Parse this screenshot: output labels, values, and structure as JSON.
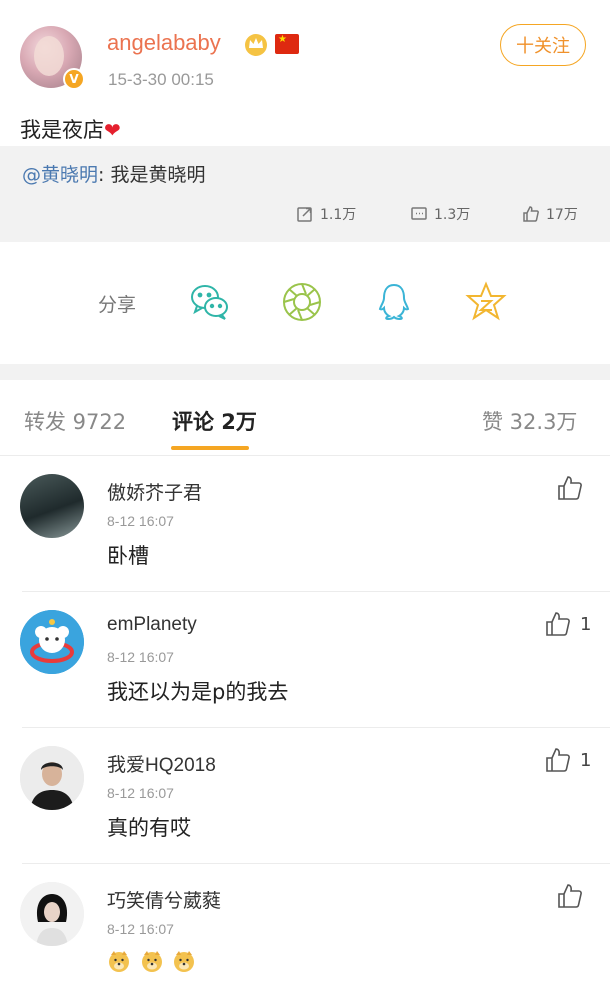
{
  "post": {
    "username": "angelababy",
    "time": "15-3-30 00:15",
    "follow_label": "十关注",
    "verified_mark": "V",
    "text": "我是夜店",
    "heart": "❤"
  },
  "repost": {
    "mention": "@黄晓明",
    "separator": ": ",
    "text": "我是黄晓明",
    "stats": {
      "reposts": "1.1万",
      "comments": "1.3万",
      "likes": "17万"
    }
  },
  "share": {
    "label": "分享",
    "icons": [
      "wechat-icon",
      "moments-icon",
      "qq-icon",
      "qzone-icon"
    ]
  },
  "tabs": {
    "reposts": "转发 9722",
    "comments": "评论 2万",
    "likes": "赞 32.3万"
  },
  "comments": [
    {
      "name": "傲娇芥子君",
      "time": "8-12 16:07",
      "text": "卧槽",
      "likes": ""
    },
    {
      "name": "emPlanety",
      "time": "8-12 16:07",
      "text": "我还以为是p的我去",
      "likes": "1"
    },
    {
      "name": "我爱HQ2018",
      "time": "8-12 16:07",
      "text": "真的有哎",
      "likes": "1"
    },
    {
      "name": "巧笑倩兮葳蕤",
      "time": "8-12 16:07",
      "text": "",
      "likes": "",
      "emoji": [
        "doge-emoji",
        "doge-emoji",
        "doge-emoji"
      ]
    }
  ],
  "colors": {
    "username": "#eb7350",
    "accent": "#f5a623",
    "mention": "#4b79b0"
  }
}
